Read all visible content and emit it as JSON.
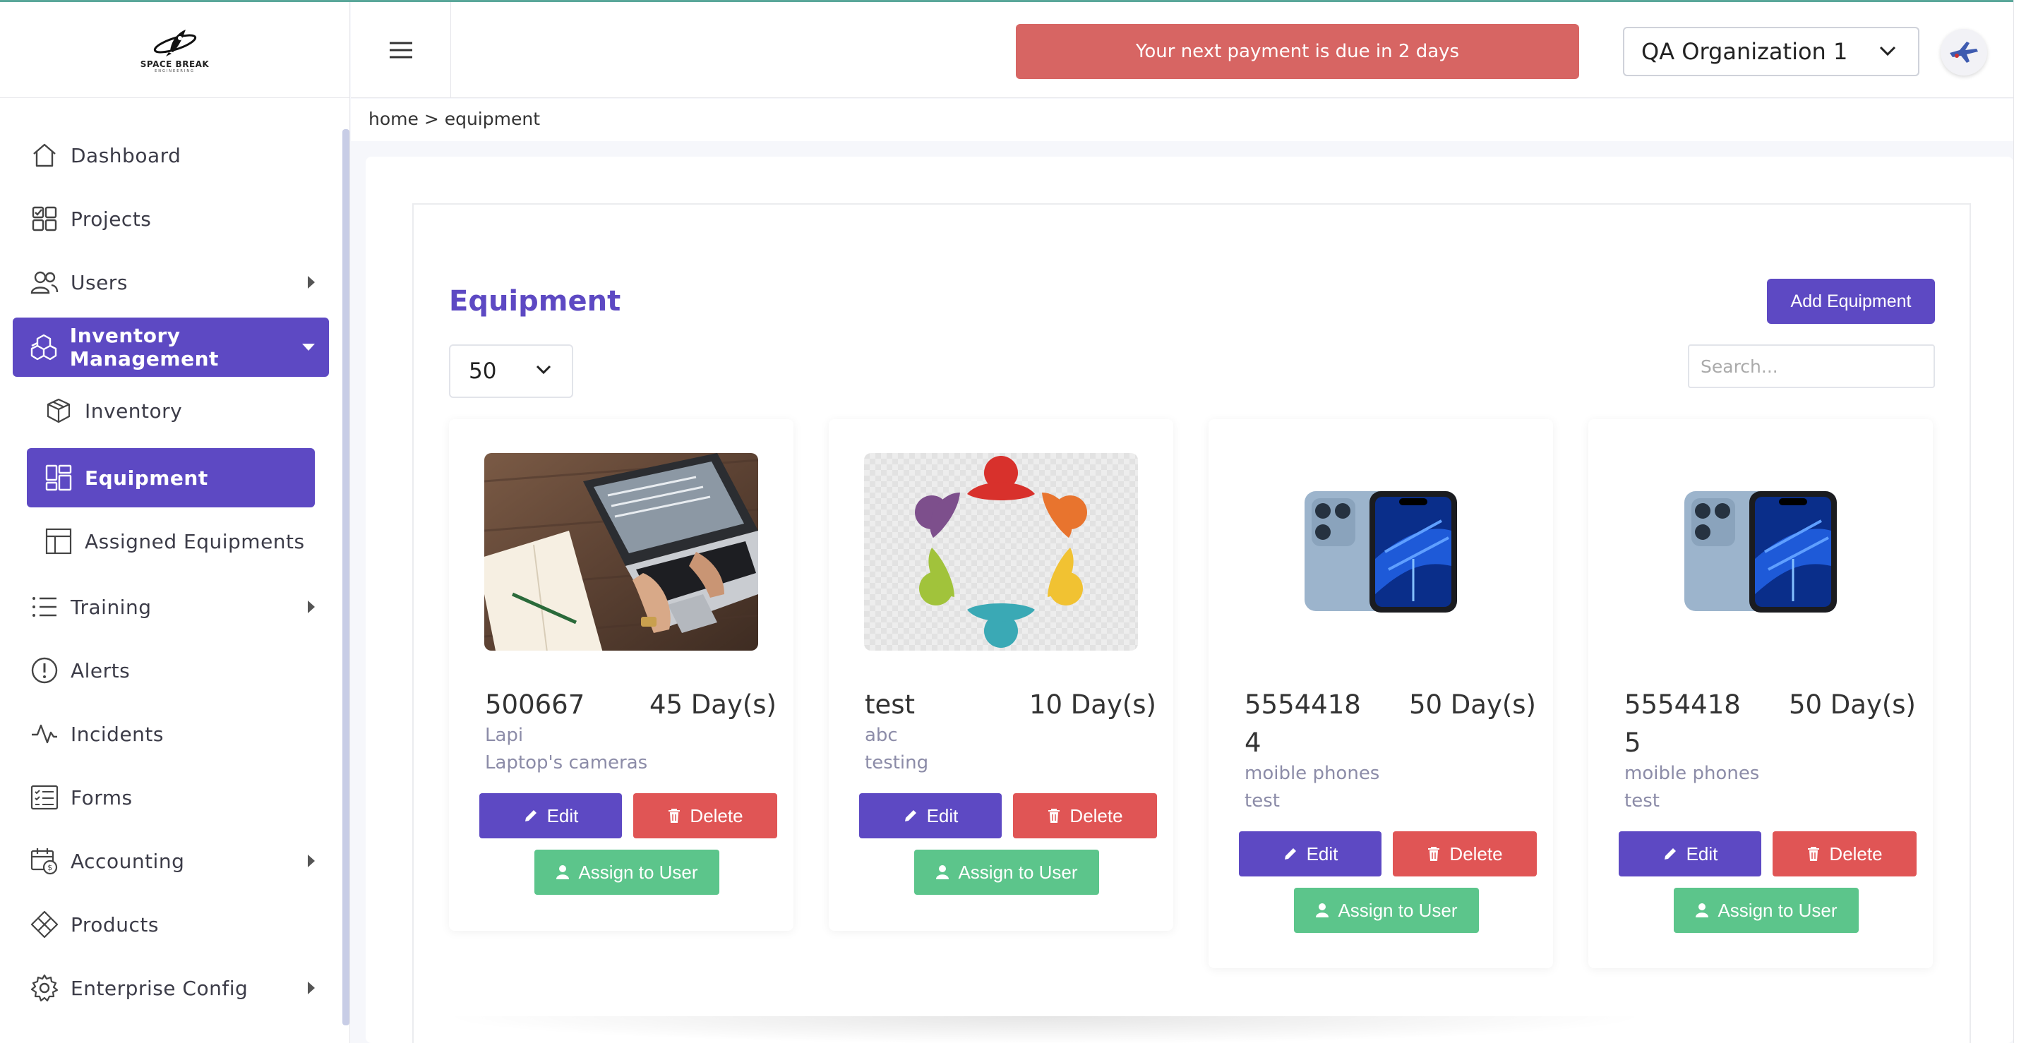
{
  "brand": {
    "name": "SPACE BREAK",
    "tagline": "ENGINEERING"
  },
  "header": {
    "payment_notice": "Your next payment is due in 2 days",
    "organization": "QA Organization 1"
  },
  "breadcrumb": "home > equipment",
  "sidebar": {
    "items": [
      {
        "label": "Dashboard",
        "icon": "home-icon"
      },
      {
        "label": "Projects",
        "icon": "projects-icon"
      },
      {
        "label": "Users",
        "icon": "users-icon"
      },
      {
        "label": "Inventory Management",
        "icon": "boxes-icon"
      },
      {
        "label": "Inventory",
        "icon": "box-icon"
      },
      {
        "label": "Equipment",
        "icon": "grid-icon"
      },
      {
        "label": "Assigned Equipments",
        "icon": "layout-icon"
      },
      {
        "label": "Training",
        "icon": "list-icon"
      },
      {
        "label": "Alerts",
        "icon": "alert-icon"
      },
      {
        "label": "Incidents",
        "icon": "activity-icon"
      },
      {
        "label": "Forms",
        "icon": "form-icon"
      },
      {
        "label": "Accounting",
        "icon": "accounting-icon"
      },
      {
        "label": "Products",
        "icon": "diamond-icon"
      },
      {
        "label": "Enterprise Config",
        "icon": "gear-icon"
      }
    ]
  },
  "main": {
    "title": "Equipment",
    "add_button": "Add Equipment",
    "page_size": "50",
    "search_placeholder": "Search...",
    "buttons": {
      "edit": "Edit",
      "delete": "Delete",
      "assign": "Assign to User"
    }
  },
  "equipment": [
    {
      "serial": "500667",
      "days": "45 Day(s)",
      "name": "Lapi",
      "description": "Laptop's cameras",
      "image": "laptop-photo"
    },
    {
      "serial": "test",
      "days": "10 Day(s)",
      "name": "abc",
      "description": "testing",
      "image": "team-circle-logo"
    },
    {
      "serial": "5554418\n4",
      "days": "50 Day(s)",
      "name": "moible phones",
      "description": "test",
      "image": "iphone-photo"
    },
    {
      "serial": "5554418\n5",
      "days": "50 Day(s)",
      "name": "moible phones",
      "description": "test",
      "image": "iphone-photo"
    }
  ],
  "colors": {
    "accent": "#5d49c3",
    "danger": "#e05555",
    "success": "#5cc58b",
    "banner": "#d76563"
  }
}
